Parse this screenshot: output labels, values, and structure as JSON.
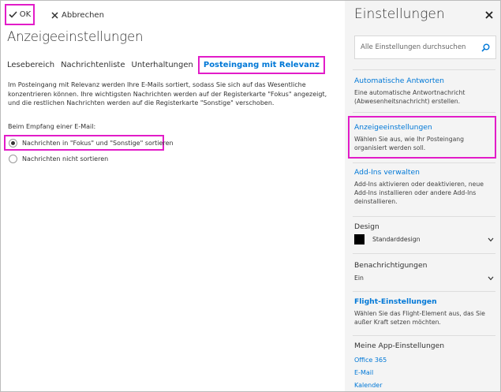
{
  "toolbar": {
    "ok_label": "OK",
    "cancel_label": "Abbrechen"
  },
  "page": {
    "title": "Anzeigeeinstellungen",
    "tabs": [
      {
        "label": "Lesebereich"
      },
      {
        "label": "Nachrichtenliste"
      },
      {
        "label": "Unterhaltungen"
      },
      {
        "label": "Posteingang mit Relevanz",
        "active": true
      }
    ],
    "description": "Im Posteingang mit Relevanz werden Ihre E-Mails sortiert, sodass Sie sich auf das Wesentliche konzentrieren können. Ihre wichtigsten Nachrichten werden auf der Registerkarte \"Fokus\" angezeigt, und die restlichen Nachrichten werden auf die Registerkarte \"Sonstige\" verschoben.",
    "receive_label": "Beim Empfang einer E-Mail:",
    "options": [
      {
        "label": "Nachrichten in \"Fokus\" und \"Sonstige\" sortieren",
        "selected": true
      },
      {
        "label": "Nachrichten nicht sortieren",
        "selected": false
      }
    ]
  },
  "settings": {
    "title": "Einstellungen",
    "search_placeholder": "Alle Einstellungen durchsuchen",
    "sections": {
      "auto_reply": {
        "link": "Automatische Antworten",
        "desc": "Eine automatische Antwortnachricht (Abwesenheitsnachricht) erstellen."
      },
      "display": {
        "link": "Anzeigeeinstellungen",
        "desc": "Wählen Sie aus, wie Ihr Posteingang organisiert werden soll."
      },
      "addins": {
        "link": "Add-Ins verwalten",
        "desc": "Add-Ins aktivieren oder deaktivieren, neue Add-Ins installieren oder andere Add-Ins deinstallieren."
      },
      "design": {
        "heading": "Design",
        "value": "Standarddesign"
      },
      "notifications": {
        "heading": "Benachrichtigungen",
        "value": "Ein"
      },
      "flight": {
        "link": "Flight-Einstellungen",
        "desc": "Wählen Sie das Flight-Element aus, das Sie außer Kraft setzen möchten."
      },
      "apps": {
        "heading": "Meine App-Einstellungen",
        "links": [
          "Office 365",
          "E-Mail",
          "Kalender"
        ]
      }
    }
  },
  "colors": {
    "accent": "#0078d7",
    "highlight": "#e21cc8",
    "panel_bg": "#f4f4f4"
  },
  "icons": {
    "ok": "checkmark-icon",
    "cancel": "close-icon",
    "search": "search-icon",
    "close_panel": "close-icon",
    "expand": "chevron-down-icon"
  }
}
